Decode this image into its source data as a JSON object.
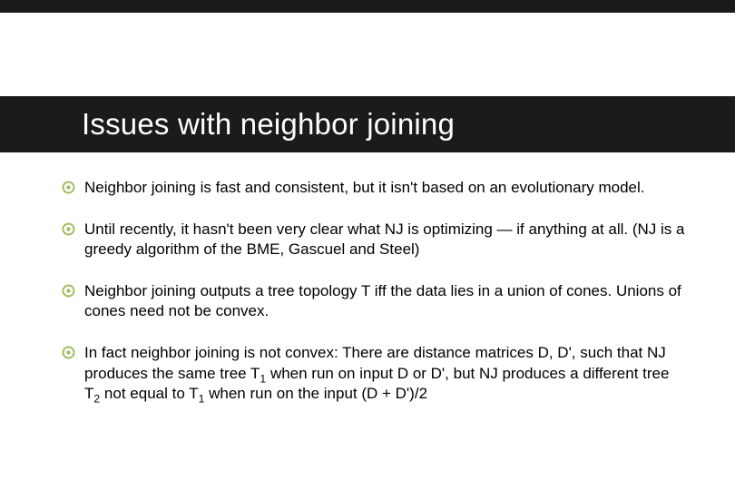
{
  "slide": {
    "title": "Issues with neighbor joining",
    "bullets": [
      {
        "text": "Neighbor joining is fast and consistent, but it isn't based on an evolutionary model."
      },
      {
        "text": "Until recently, it hasn't been very clear what NJ is optimizing — if anything at all.  (NJ is a greedy algorithm of the BME, Gascuel and Steel)"
      },
      {
        "text": "Neighbor joining outputs a tree topology T iff the data lies in a union of cones. Unions of cones need not be convex."
      },
      {
        "text_html": "In fact neighbor joining is not convex: There are distance matrices D, D', such that NJ produces the same tree T<sub>1</sub> when run on input D or D', but NJ produces a different tree T<sub>2</sub> not equal to T<sub>1</sub> when run on the input (D + D')/2"
      }
    ]
  },
  "colors": {
    "accent": "#9bbb59",
    "title_band": "#1b1b1b"
  }
}
